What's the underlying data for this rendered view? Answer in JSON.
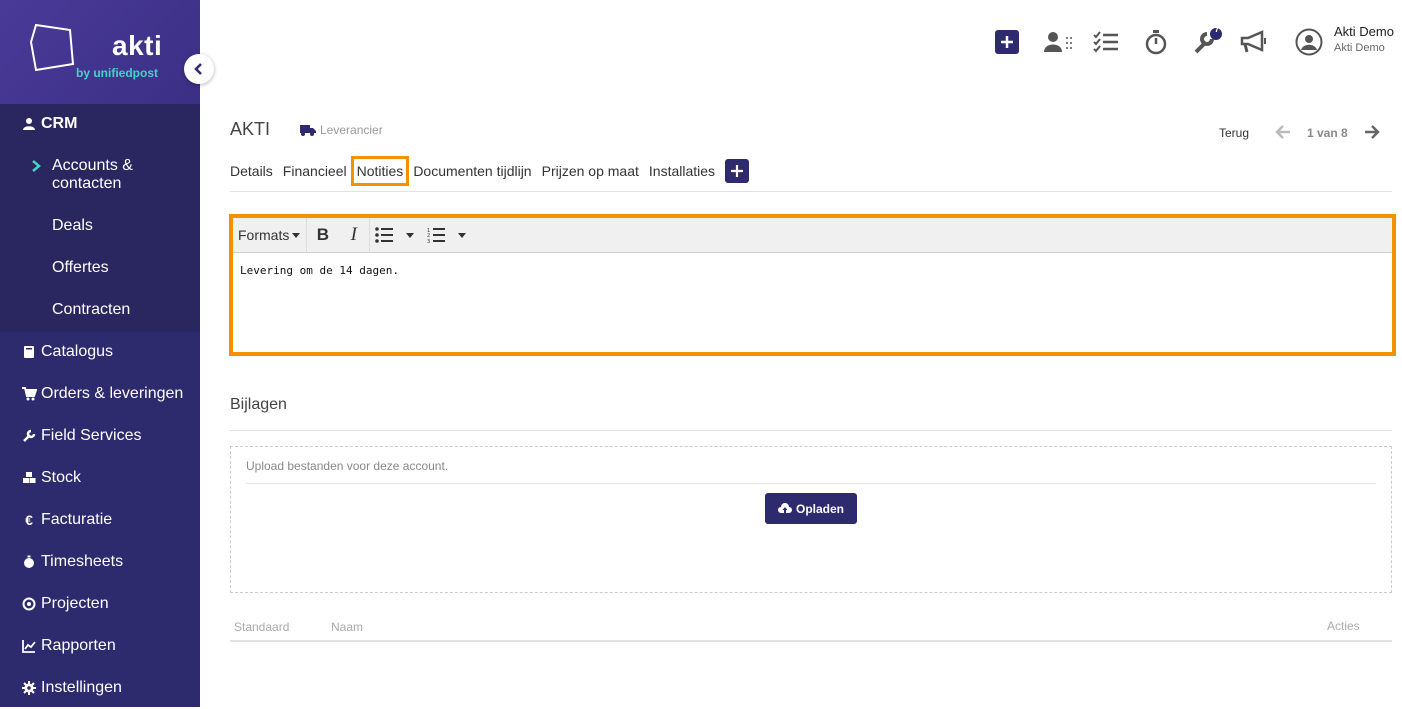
{
  "brand": {
    "name": "akti",
    "sub": "by unifiedpost"
  },
  "sidebar": {
    "crm_label": "CRM",
    "crm_subitems": [
      "Accounts &",
      "contacten",
      "Deals",
      "Offertes",
      "Contracten"
    ],
    "items": [
      "Catalogus",
      "Orders & leveringen",
      "Field Services",
      "Stock",
      "Facturatie",
      "Timesheets",
      "Projecten",
      "Rapporten",
      "Instellingen"
    ]
  },
  "topbar": {
    "notification_count": "7",
    "user_name": "Akti Demo",
    "user_company": "Akti Demo"
  },
  "header": {
    "title": "AKTI",
    "type_label": "Leverancier",
    "back_label": "Terug",
    "pager": "1 van 8"
  },
  "tabs": [
    "Details",
    "Financieel",
    "Notities",
    "Documenten tijdlijn",
    "Prijzen op maat",
    "Installaties"
  ],
  "editor": {
    "formats_label": "Formats",
    "content": "Levering om de 14 dagen."
  },
  "attachments": {
    "title": "Bijlagen",
    "upload_hint": "Upload bestanden voor deze account.",
    "upload_button": "Opladen",
    "columns": [
      "Standaard",
      "Naam",
      "Acties"
    ]
  },
  "colors": {
    "sidebar": "#2e2a6e",
    "accent": "#f39200",
    "primary": "#2e2a6e"
  }
}
